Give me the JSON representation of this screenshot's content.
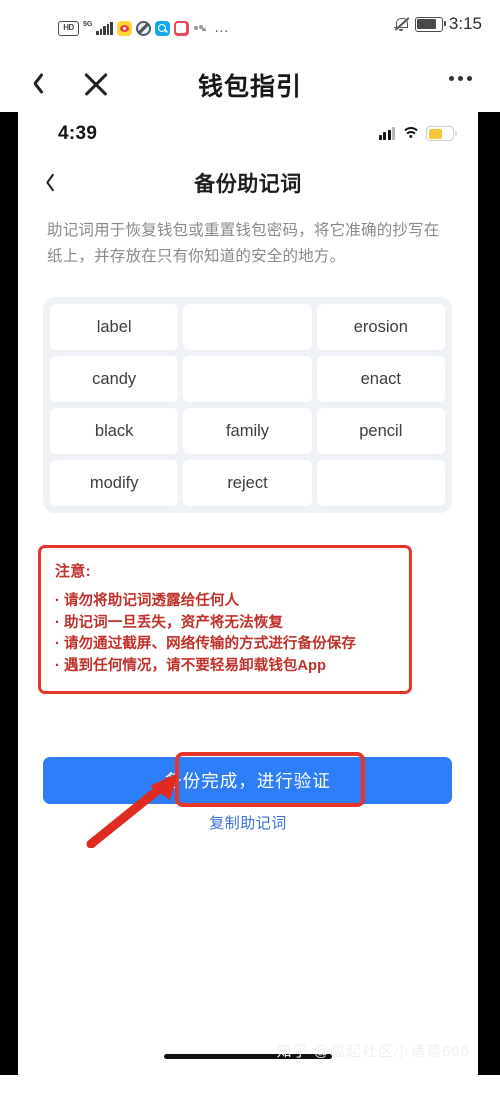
{
  "outer": {
    "status_bar": {
      "hd_label": "HD",
      "network_label": "5G",
      "time": "3:15",
      "app_icons": [
        "weibo-icon",
        "globe-icon",
        "qq-browser-icon",
        "pink-app-icon",
        "misc-app-icon"
      ],
      "overflow_label": "…",
      "mute_icon": "bell-muted-icon",
      "battery_icon": "battery-icon"
    },
    "nav": {
      "back_icon": "chevron-left-icon",
      "close_icon": "close-icon",
      "title": "钱包指引",
      "more_icon": "more-dots-icon"
    }
  },
  "inner": {
    "status_bar": {
      "time": "4:39",
      "signal_icon": "signal-bars-icon",
      "wifi_icon": "wifi-icon",
      "battery_icon": "battery-low-icon"
    },
    "nav": {
      "back_icon": "chevron-left-icon",
      "title": "备份助记词"
    },
    "description": "助记词用于恢复钱包或重置钱包密码，将它准确的抄写在纸上，并存放在只有你知道的安全的地方。",
    "mnemonic_words": [
      "label",
      "",
      "erosion",
      "candy",
      "",
      "enact",
      "black",
      "family",
      "pencil",
      "modify",
      "reject",
      ""
    ],
    "warning": {
      "title": "注意:",
      "items": [
        "请勿将助记词透露给任何人",
        "助记词一旦丢失，资产将无法恢复",
        "请勿通过截屏、网络传输的方式进行备份保存",
        "遇到任何情况，请不要轻易卸载钱包App"
      ]
    },
    "primary_button": "备份完成，进行验证",
    "copy_link": "复制助记词"
  },
  "annotation": {
    "highlight_color": "#e5342a",
    "arrow_name": "red-pointer-arrow"
  },
  "colors": {
    "primary_button": "#2d7df6",
    "warning_red": "#e5342a",
    "link_blue": "#3b6fd4",
    "grid_background": "#eef1f6"
  },
  "watermark": "知乎 @幅起社区小诸葛666"
}
